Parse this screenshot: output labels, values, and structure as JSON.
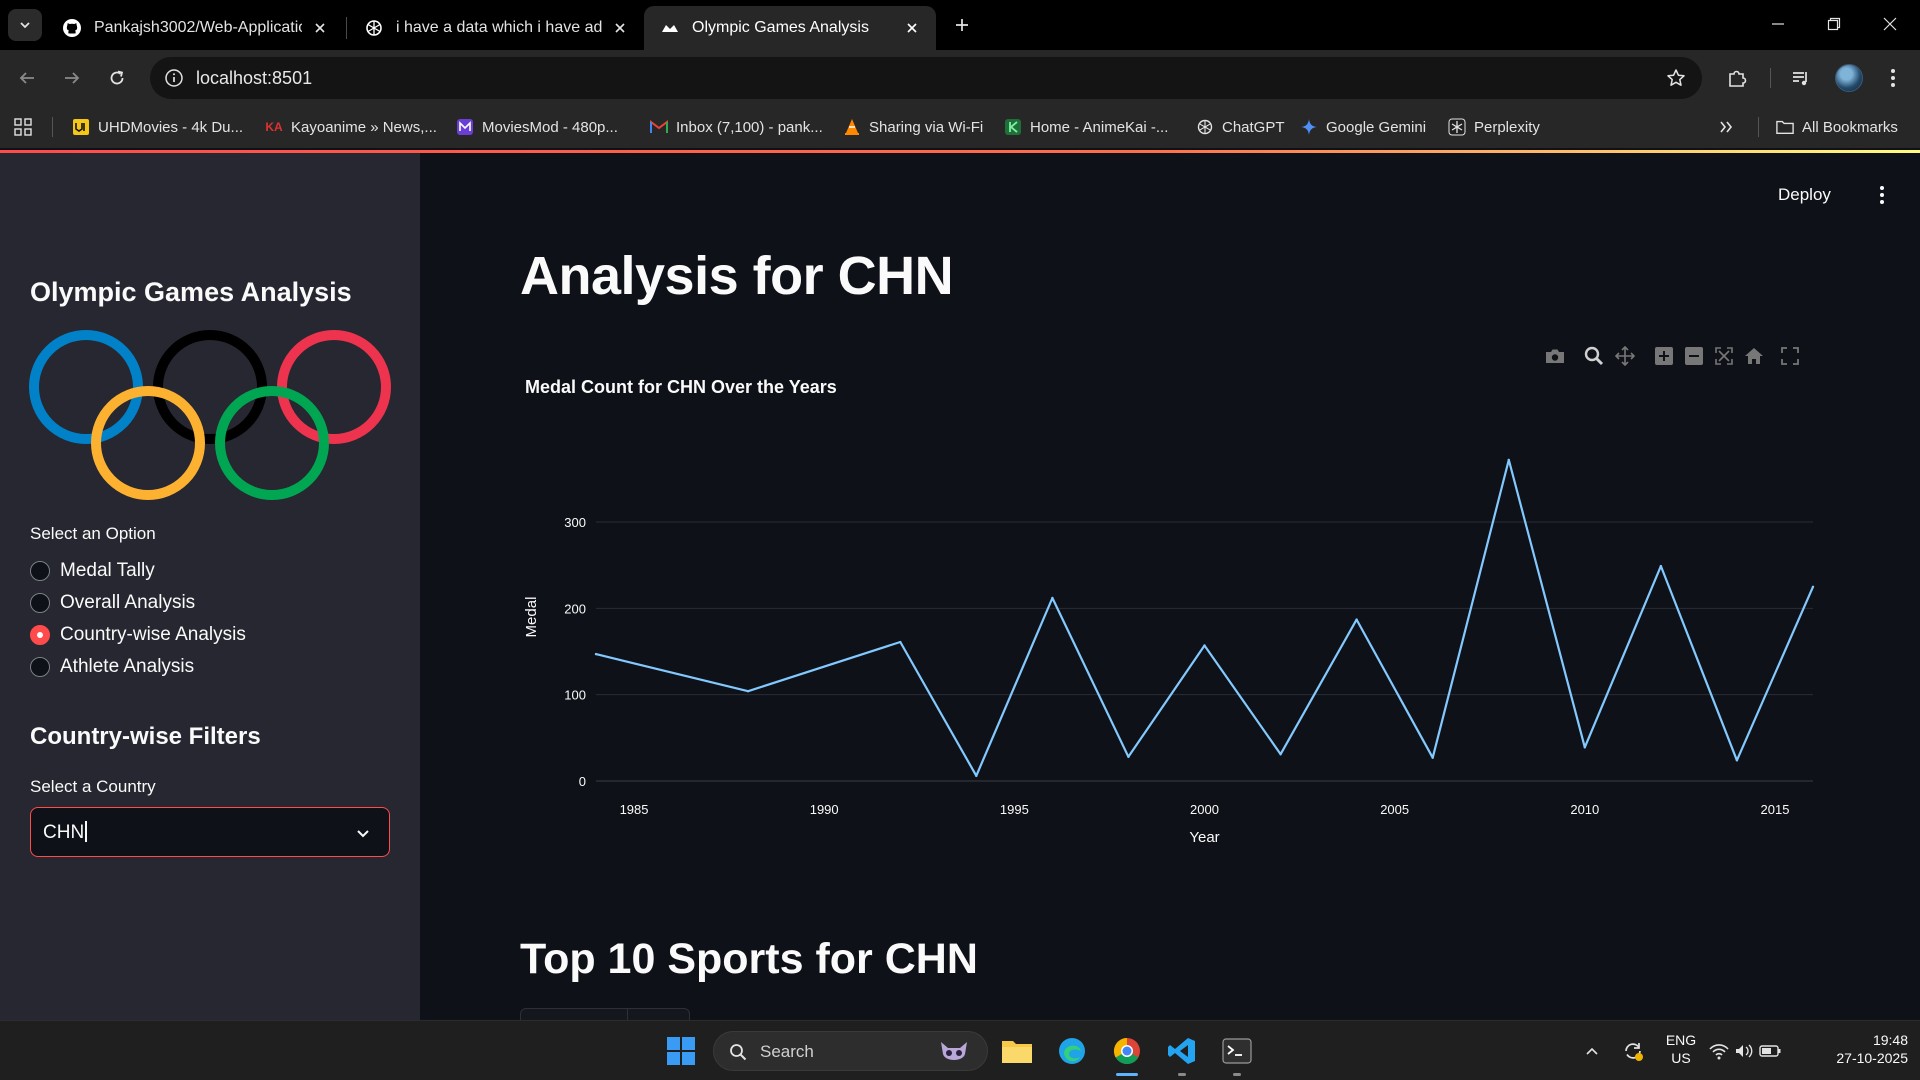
{
  "browser": {
    "tabs": [
      {
        "title": "Pankajsh3002/Web-Application",
        "favicon": "github-icon",
        "active": false
      },
      {
        "title": "i have a data which i have adde",
        "favicon": "chatgpt-icon",
        "active": false
      },
      {
        "title": "Olympic Games Analysis",
        "favicon": "streamlit-icon",
        "active": true
      }
    ],
    "url": "localhost:8501",
    "bookmarks": [
      {
        "label": "UHDMovies - 4k Du...",
        "icon": "uhd-icon"
      },
      {
        "label": "Kayoanime » News,...",
        "icon": "ka-icon"
      },
      {
        "label": "MoviesMod - 480p...",
        "icon": "m-icon"
      },
      {
        "label": "Inbox (7,100) - pank...",
        "icon": "gmail-icon"
      },
      {
        "label": "Sharing via Wi-Fi",
        "icon": "vlc-icon"
      },
      {
        "label": "Home - AnimeKai -...",
        "icon": "k-icon"
      },
      {
        "label": "ChatGPT",
        "icon": "chatgpt-icon"
      },
      {
        "label": "Google Gemini",
        "icon": "gemini-icon"
      },
      {
        "label": "Perplexity",
        "icon": "perplexity-icon"
      }
    ],
    "all_bookmarks_label": "All Bookmarks"
  },
  "sidebar": {
    "title": "Olympic Games Analysis",
    "select_option_label": "Select an Option",
    "options": [
      {
        "label": "Medal Tally",
        "selected": false
      },
      {
        "label": "Overall Analysis",
        "selected": false
      },
      {
        "label": "Country-wise Analysis",
        "selected": true
      },
      {
        "label": "Athlete Analysis",
        "selected": false
      }
    ],
    "filters_title": "Country-wise Filters",
    "country_label": "Select a Country",
    "country_value": "CHN"
  },
  "app": {
    "deploy_label": "Deploy",
    "page_title": "Analysis for CHN",
    "section_title": "Top 10 Sports for CHN",
    "accent_color": "#ff4b4b"
  },
  "chart_data": {
    "type": "line",
    "title": "Medal Count for CHN Over the Years",
    "xlabel": "Year",
    "ylabel": "Medal",
    "x": [
      1984,
      1988,
      1992,
      1994,
      1996,
      1998,
      2000,
      2002,
      2004,
      2006,
      2008,
      2010,
      2012,
      2014,
      2016
    ],
    "values": [
      147,
      104,
      161,
      6,
      212,
      28,
      157,
      31,
      187,
      27,
      372,
      39,
      249,
      24,
      225
    ],
    "xticks": [
      1985,
      1990,
      1995,
      2000,
      2005,
      2010,
      2015
    ],
    "yticks": [
      0,
      100,
      200,
      300
    ],
    "xlim": [
      1984,
      2016
    ],
    "ylim": [
      0,
      380
    ],
    "line_color": "#83c9ff",
    "grid": true
  },
  "taskbar": {
    "search_label": "Search",
    "lang_top": "ENG",
    "lang_bottom": "US",
    "time": "19:48",
    "date": "27-10-2025"
  }
}
